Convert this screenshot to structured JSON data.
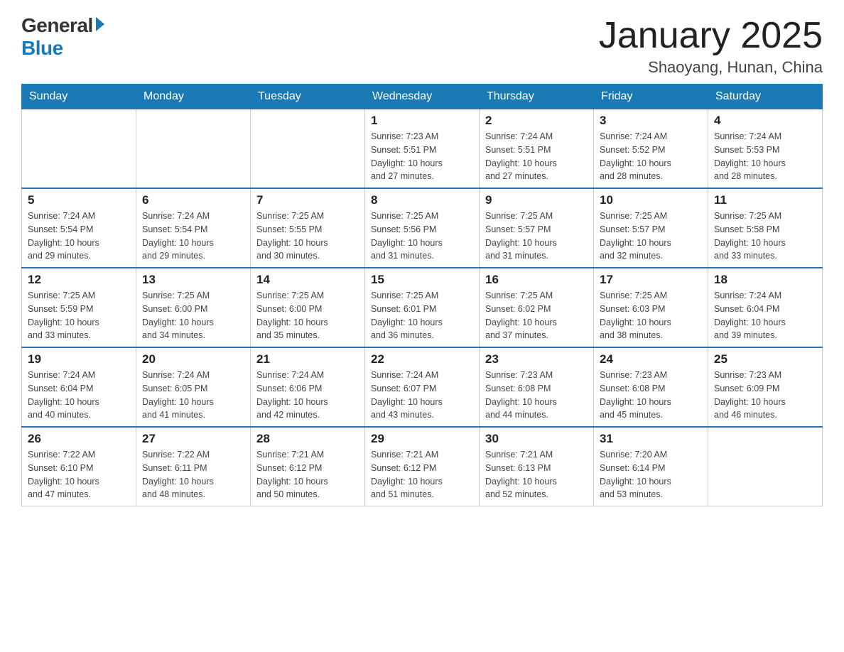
{
  "header": {
    "logo_general": "General",
    "logo_blue": "Blue",
    "month_title": "January 2025",
    "location": "Shaoyang, Hunan, China"
  },
  "weekdays": [
    "Sunday",
    "Monday",
    "Tuesday",
    "Wednesday",
    "Thursday",
    "Friday",
    "Saturday"
  ],
  "weeks": [
    {
      "days": [
        {
          "number": "",
          "info": ""
        },
        {
          "number": "",
          "info": ""
        },
        {
          "number": "",
          "info": ""
        },
        {
          "number": "1",
          "info": "Sunrise: 7:23 AM\nSunset: 5:51 PM\nDaylight: 10 hours\nand 27 minutes."
        },
        {
          "number": "2",
          "info": "Sunrise: 7:24 AM\nSunset: 5:51 PM\nDaylight: 10 hours\nand 27 minutes."
        },
        {
          "number": "3",
          "info": "Sunrise: 7:24 AM\nSunset: 5:52 PM\nDaylight: 10 hours\nand 28 minutes."
        },
        {
          "number": "4",
          "info": "Sunrise: 7:24 AM\nSunset: 5:53 PM\nDaylight: 10 hours\nand 28 minutes."
        }
      ]
    },
    {
      "days": [
        {
          "number": "5",
          "info": "Sunrise: 7:24 AM\nSunset: 5:54 PM\nDaylight: 10 hours\nand 29 minutes."
        },
        {
          "number": "6",
          "info": "Sunrise: 7:24 AM\nSunset: 5:54 PM\nDaylight: 10 hours\nand 29 minutes."
        },
        {
          "number": "7",
          "info": "Sunrise: 7:25 AM\nSunset: 5:55 PM\nDaylight: 10 hours\nand 30 minutes."
        },
        {
          "number": "8",
          "info": "Sunrise: 7:25 AM\nSunset: 5:56 PM\nDaylight: 10 hours\nand 31 minutes."
        },
        {
          "number": "9",
          "info": "Sunrise: 7:25 AM\nSunset: 5:57 PM\nDaylight: 10 hours\nand 31 minutes."
        },
        {
          "number": "10",
          "info": "Sunrise: 7:25 AM\nSunset: 5:57 PM\nDaylight: 10 hours\nand 32 minutes."
        },
        {
          "number": "11",
          "info": "Sunrise: 7:25 AM\nSunset: 5:58 PM\nDaylight: 10 hours\nand 33 minutes."
        }
      ]
    },
    {
      "days": [
        {
          "number": "12",
          "info": "Sunrise: 7:25 AM\nSunset: 5:59 PM\nDaylight: 10 hours\nand 33 minutes."
        },
        {
          "number": "13",
          "info": "Sunrise: 7:25 AM\nSunset: 6:00 PM\nDaylight: 10 hours\nand 34 minutes."
        },
        {
          "number": "14",
          "info": "Sunrise: 7:25 AM\nSunset: 6:00 PM\nDaylight: 10 hours\nand 35 minutes."
        },
        {
          "number": "15",
          "info": "Sunrise: 7:25 AM\nSunset: 6:01 PM\nDaylight: 10 hours\nand 36 minutes."
        },
        {
          "number": "16",
          "info": "Sunrise: 7:25 AM\nSunset: 6:02 PM\nDaylight: 10 hours\nand 37 minutes."
        },
        {
          "number": "17",
          "info": "Sunrise: 7:25 AM\nSunset: 6:03 PM\nDaylight: 10 hours\nand 38 minutes."
        },
        {
          "number": "18",
          "info": "Sunrise: 7:24 AM\nSunset: 6:04 PM\nDaylight: 10 hours\nand 39 minutes."
        }
      ]
    },
    {
      "days": [
        {
          "number": "19",
          "info": "Sunrise: 7:24 AM\nSunset: 6:04 PM\nDaylight: 10 hours\nand 40 minutes."
        },
        {
          "number": "20",
          "info": "Sunrise: 7:24 AM\nSunset: 6:05 PM\nDaylight: 10 hours\nand 41 minutes."
        },
        {
          "number": "21",
          "info": "Sunrise: 7:24 AM\nSunset: 6:06 PM\nDaylight: 10 hours\nand 42 minutes."
        },
        {
          "number": "22",
          "info": "Sunrise: 7:24 AM\nSunset: 6:07 PM\nDaylight: 10 hours\nand 43 minutes."
        },
        {
          "number": "23",
          "info": "Sunrise: 7:23 AM\nSunset: 6:08 PM\nDaylight: 10 hours\nand 44 minutes."
        },
        {
          "number": "24",
          "info": "Sunrise: 7:23 AM\nSunset: 6:08 PM\nDaylight: 10 hours\nand 45 minutes."
        },
        {
          "number": "25",
          "info": "Sunrise: 7:23 AM\nSunset: 6:09 PM\nDaylight: 10 hours\nand 46 minutes."
        }
      ]
    },
    {
      "days": [
        {
          "number": "26",
          "info": "Sunrise: 7:22 AM\nSunset: 6:10 PM\nDaylight: 10 hours\nand 47 minutes."
        },
        {
          "number": "27",
          "info": "Sunrise: 7:22 AM\nSunset: 6:11 PM\nDaylight: 10 hours\nand 48 minutes."
        },
        {
          "number": "28",
          "info": "Sunrise: 7:21 AM\nSunset: 6:12 PM\nDaylight: 10 hours\nand 50 minutes."
        },
        {
          "number": "29",
          "info": "Sunrise: 7:21 AM\nSunset: 6:12 PM\nDaylight: 10 hours\nand 51 minutes."
        },
        {
          "number": "30",
          "info": "Sunrise: 7:21 AM\nSunset: 6:13 PM\nDaylight: 10 hours\nand 52 minutes."
        },
        {
          "number": "31",
          "info": "Sunrise: 7:20 AM\nSunset: 6:14 PM\nDaylight: 10 hours\nand 53 minutes."
        },
        {
          "number": "",
          "info": ""
        }
      ]
    }
  ]
}
